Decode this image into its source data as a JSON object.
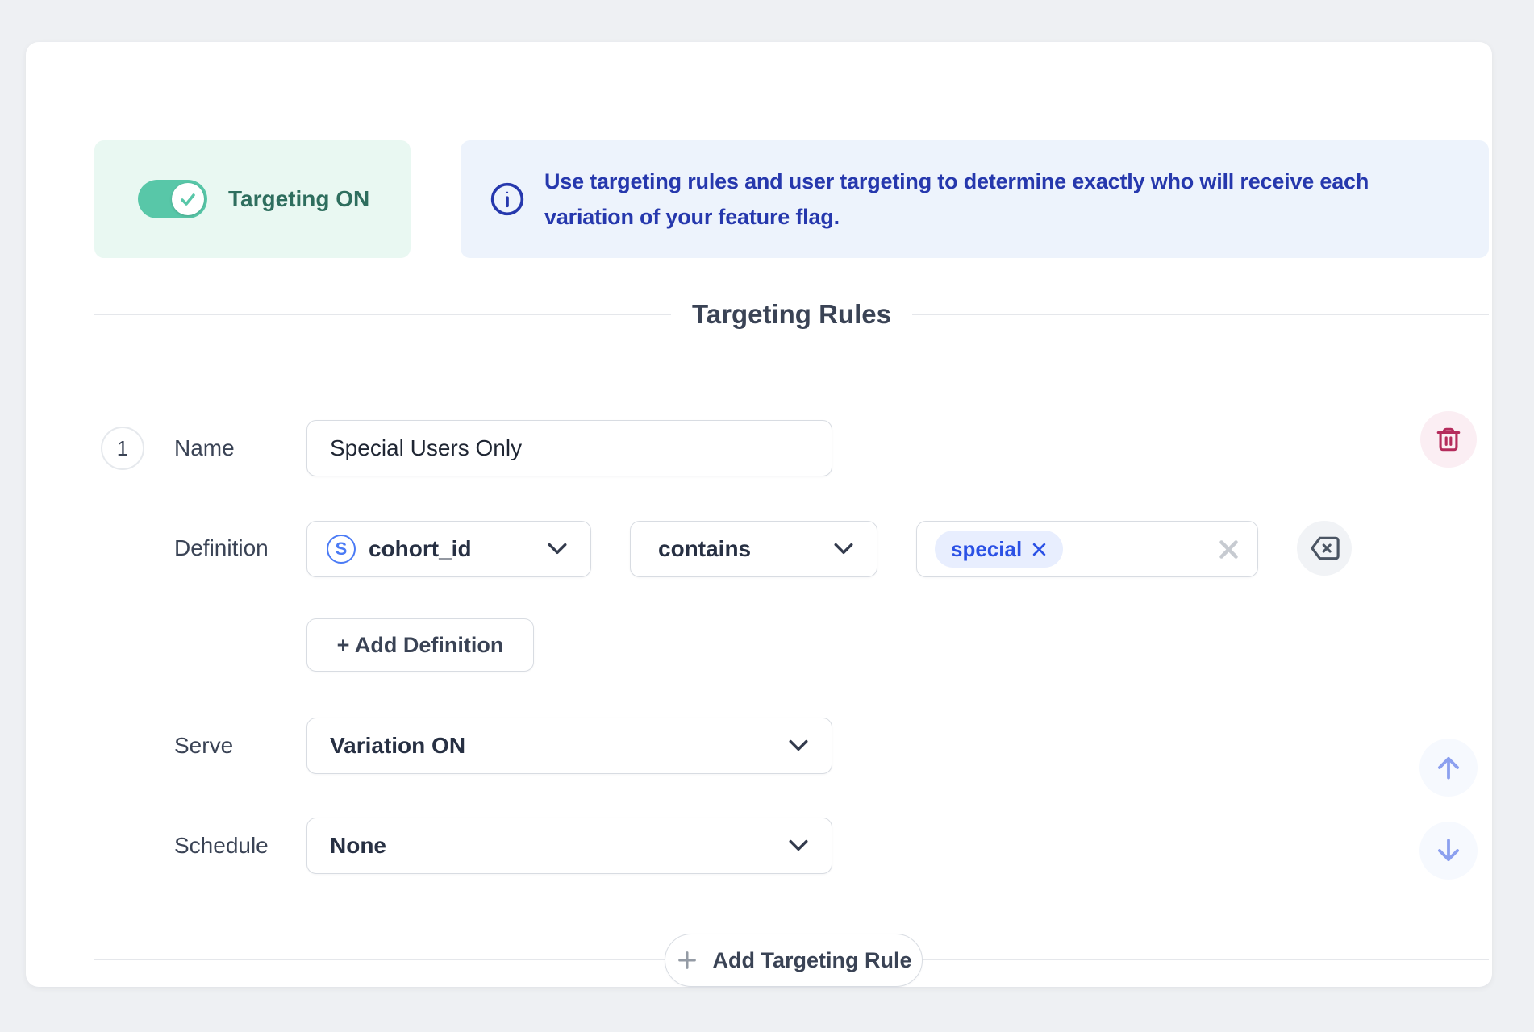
{
  "toggle": {
    "label": "Targeting ON",
    "state": "on"
  },
  "banner": {
    "text": "Use targeting rules and user targeting to determine exactly who will receive each variation of your feature flag."
  },
  "section": {
    "title": "Targeting Rules"
  },
  "rule": {
    "number": "1",
    "name": {
      "label": "Name",
      "value": "Special Users Only"
    },
    "definition": {
      "label": "Definition",
      "field": "cohort_id",
      "field_icon_letter": "S",
      "operator": "contains",
      "tag": "special"
    },
    "add_definition_label": "+ Add Definition",
    "serve": {
      "label": "Serve",
      "value": "Variation ON"
    },
    "schedule": {
      "label": "Schedule",
      "value": "None"
    }
  },
  "footer": {
    "add_rule_label": "Add Targeting Rule"
  },
  "icons": [
    "toggle-check-icon",
    "info-icon",
    "s-circle-icon",
    "chevron-down-icon",
    "tag-remove-x-icon",
    "clear-x-icon",
    "backspace-icon",
    "trash-icon",
    "arrow-up-icon",
    "arrow-down-icon",
    "plus-icon"
  ],
  "colors": {
    "page_bg": "#eef0f3",
    "card_bg": "#ffffff",
    "mint_bg": "#e9f8f2",
    "toggle_teal": "#58c7a8",
    "teal_text": "#2e6e5e",
    "banner_bg": "#edf3fc",
    "banner_blue": "#2638ad",
    "tag_bg": "#e8eefe",
    "tag_blue": "#2b51e5",
    "field_icon_blue": "#4b7bf5",
    "danger": "#b52c5c",
    "danger_bg": "#fbeef3",
    "arrow_blue": "#8ca0ef",
    "border": "#d8dce2"
  }
}
